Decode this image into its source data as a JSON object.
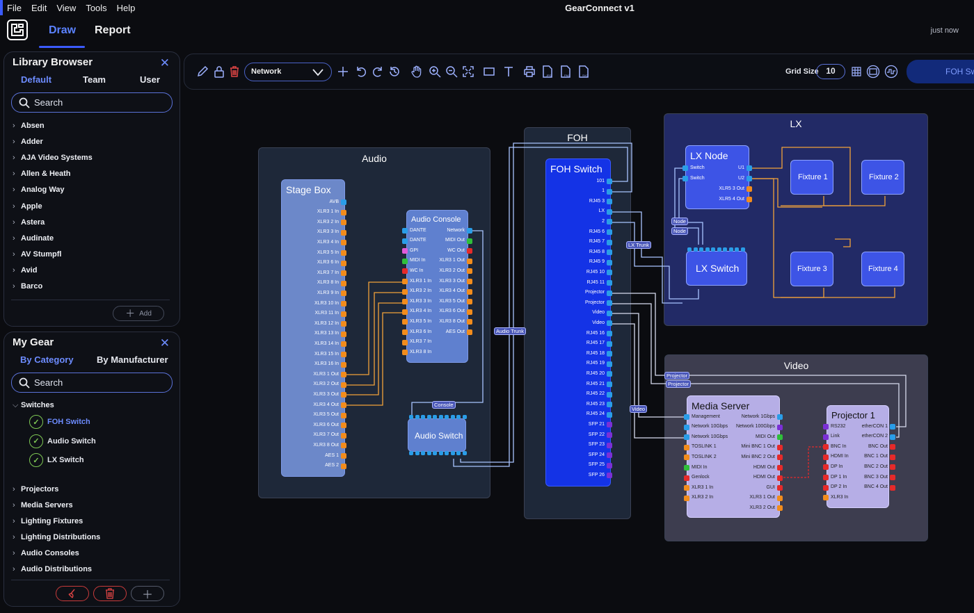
{
  "menu": [
    "File",
    "Edit",
    "View",
    "Tools",
    "Help"
  ],
  "app_title": "GearConnect  v1",
  "tabs": [
    "Draw",
    "Report"
  ],
  "saved_status": "just now",
  "library": {
    "title": "Library Browser",
    "tabs": [
      "Default",
      "Team",
      "User"
    ],
    "search_placeholder": "Search",
    "items": [
      "Absen",
      "Adder",
      "AJA Video Systems",
      "Allen & Heath",
      "Analog Way",
      "Apple",
      "Astera",
      "Audinate",
      "AV Stumpfl",
      "Avid",
      "Barco"
    ],
    "add_label": "Add"
  },
  "my_gear": {
    "title": "My Gear",
    "tabs": [
      "By Category",
      "By Manufacturer"
    ],
    "search_placeholder": "Search",
    "categories": [
      {
        "name": "Switches",
        "expanded": true,
        "children": [
          "FOH Switch",
          "Audio Switch",
          "LX Switch"
        ]
      },
      {
        "name": "Projectors"
      },
      {
        "name": "Media Servers"
      },
      {
        "name": "Lighting Fixtures"
      },
      {
        "name": "Lighting Distributions"
      },
      {
        "name": "Audio Consoles"
      },
      {
        "name": "Audio Distributions"
      }
    ]
  },
  "toolbar": {
    "layer_select": "Network",
    "grid_size_label": "Grid Size",
    "grid_size_value": "10",
    "foh_button": "FOH Sw"
  },
  "colors": {
    "accent": "#3b5bff",
    "port_orange": "#f28c1c",
    "port_blue": "#2a9de8",
    "port_green": "#2fbf3a",
    "port_red": "#e52a2a",
    "port_purple": "#7b2fd6",
    "port_pink": "#e05ad8"
  },
  "canvas": {
    "groups": {
      "audio": "Audio",
      "foh": "FOH",
      "lx": "LX",
      "video": "Video"
    },
    "stage_box": {
      "title": "Stage Box",
      "ports": [
        "AVB",
        "XLR3 1 In",
        "XLR3 2 In",
        "XLR3 3 In",
        "XLR3 4 In",
        "XLR3 5 In",
        "XLR3 6 In",
        "XLR3 7 In",
        "XLR3 8 In",
        "XLR3 9 In",
        "XLR3 10 In",
        "XLR3 11 In",
        "XLR3 12 In",
        "XLR3 13 In",
        "XLR3 14 In",
        "XLR3 15 In",
        "XLR3 16 In",
        "XLR3 1 Out",
        "XLR3 2 Out",
        "XLR3 3 Out",
        "XLR3 4 Out",
        "XLR3 5 Out",
        "XLR3 6 Out",
        "XLR3 7 Out",
        "XLR3 8 Out",
        "AES 1",
        "AES 2"
      ]
    },
    "audio_console": {
      "title": "Audio Console",
      "left_ports": [
        "DANTE",
        "DANTE",
        "GPI",
        "MIDI In",
        "WC In",
        "XLR3 1 In",
        "XLR3 2 In",
        "XLR3 3 In",
        "XLR3 4 In",
        "XLR3 5 In",
        "XLR3 6 In",
        "XLR3 7 In",
        "XLR3 8 In"
      ],
      "right_ports": [
        "Network",
        "MIDI Out",
        "WC Out",
        "XLR3 1 Out",
        "XLR3 2 Out",
        "XLR3 3 Out",
        "XLR3 4 Out",
        "XLR3 5 Out",
        "XLR3 6 Out",
        "XLR3 8 Out",
        "AES Out"
      ]
    },
    "audio_switch": {
      "title": "Audio Switch"
    },
    "foh_switch": {
      "title": "FOH Switch",
      "ports": [
        "101",
        "1",
        "RJ45 3",
        "LX",
        "2",
        "RJ45 6",
        "RJ45 7",
        "RJ45 8",
        "RJ45 9",
        "RJ45 10",
        "RJ45 11",
        "Projector",
        "Projector",
        "Video",
        "Video",
        "RJ45 16",
        "RJ45 17",
        "RJ45 18",
        "RJ45 19",
        "RJ45 20",
        "RJ45 21",
        "RJ45 22",
        "RJ45 23",
        "RJ45 24",
        "SFP 21",
        "SFP 22",
        "SFP 23",
        "SFP 24",
        "SFP 25",
        "SFP 26"
      ]
    },
    "lx_node": {
      "title": "LX Node",
      "left_ports": [
        "Switch",
        "Switch"
      ],
      "right_ports": [
        "U1",
        "U2",
        "XLR5 3 Out",
        "XLR5 4 Out"
      ]
    },
    "lx_switch": {
      "title": "LX Switch"
    },
    "fixtures": [
      "Fixture 1",
      "Fixture 2",
      "Fixture 3",
      "Fixture 4"
    ],
    "media_server": {
      "title": "Media Server",
      "left_ports": [
        "Management",
        "Network 10Gbps",
        "Network 10Gbps",
        "TOSLINK 1",
        "TOSLINK 2",
        "MIDI In",
        "Genlock",
        "XLR3 1 In",
        "XLR3 2 In"
      ],
      "right_ports": [
        "Network 1Gbps",
        "Network 100Gbps",
        "MIDI Out",
        "Mini BNC 1 Out",
        "Mini BNC 2 Out",
        "HDMI Out",
        "HDMI Out",
        "GUI",
        "XLR3 1 Out",
        "XLR3 2 Out"
      ]
    },
    "projector": {
      "title": "Projector 1",
      "left_ports": [
        "RS232",
        "Link",
        "BNC In",
        "HDMI In",
        "DP In",
        "DP 1 In",
        "DP 2 In",
        "XLR3 In"
      ],
      "right_ports": [
        "etherCON 1",
        "etherCON 2",
        "BNC Out",
        "BNC 1 Out",
        "BNC 2 Out",
        "BNC 3 Out",
        "BNC 4 Out"
      ]
    },
    "tags": {
      "audio_trunk": "Audio Trunk",
      "console": "Console",
      "lx_trunk": "LX Trunk",
      "node1": "Node",
      "node2": "Node",
      "projector1": "Projector",
      "projector2": "Projector",
      "video": "Video"
    }
  }
}
